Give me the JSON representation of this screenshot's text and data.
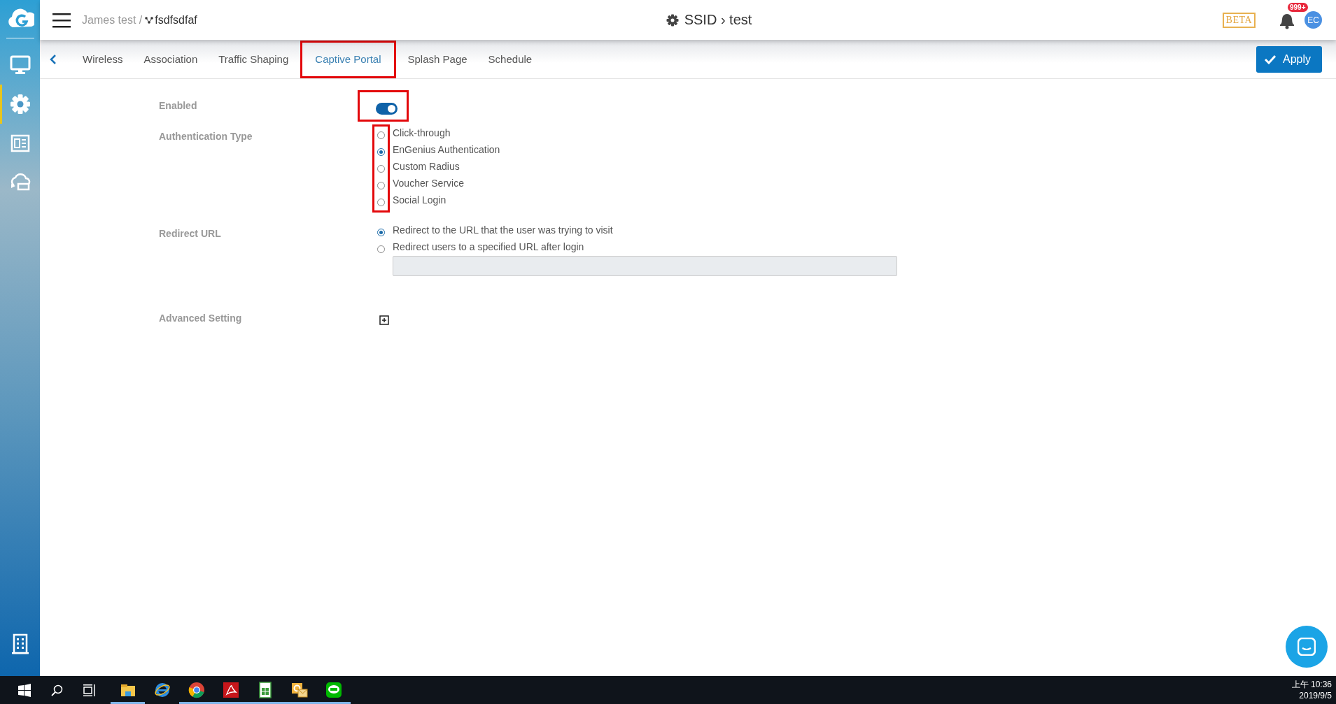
{
  "sidebar": {
    "items": [
      {
        "kind": "monitor",
        "selected": false
      },
      {
        "kind": "gear",
        "selected": true
      },
      {
        "kind": "news",
        "selected": false
      },
      {
        "kind": "cloud",
        "selected": false
      },
      {
        "kind": "building",
        "selected": false
      }
    ]
  },
  "header": {
    "org": "James test /",
    "network": "fsdfsdfaf",
    "title": "SSID › test",
    "beta": "BETA",
    "notification_count": "999+",
    "avatar": "EC"
  },
  "tabs": [
    {
      "label": "Wireless",
      "selected": false,
      "highlighted": false
    },
    {
      "label": "Association",
      "selected": false,
      "highlighted": false
    },
    {
      "label": "Traffic Shaping",
      "selected": false,
      "highlighted": false
    },
    {
      "label": "Captive Portal",
      "selected": true,
      "highlighted": true
    },
    {
      "label": "Splash Page",
      "selected": false,
      "highlighted": false
    },
    {
      "label": "Schedule",
      "selected": false,
      "highlighted": false
    }
  ],
  "apply_button": "Apply",
  "form": {
    "enabled": {
      "label": "Enabled",
      "on": true,
      "highlighted": true
    },
    "authentication_type": {
      "label": "Authentication Type",
      "highlighted": true,
      "options": [
        {
          "label": "Click-through",
          "selected": false
        },
        {
          "label": "EnGenius Authentication",
          "selected": true
        },
        {
          "label": "Custom Radius",
          "selected": false
        },
        {
          "label": "Voucher Service",
          "selected": false
        },
        {
          "label": "Social Login",
          "selected": false
        }
      ]
    },
    "redirect_url": {
      "label": "Redirect URL",
      "highlighted": false,
      "options": [
        {
          "label": "Redirect to the URL that the user was trying to visit",
          "selected": true
        },
        {
          "label": "Redirect users to a specified URL after login",
          "selected": false
        }
      ],
      "url_field": {
        "disabled": true
      }
    },
    "advanced_setting": {
      "label": "Advanced Setting",
      "expanded": false
    }
  },
  "taskbar": {
    "apps": [
      {
        "kind": "explorer",
        "running": true
      },
      {
        "kind": "ie",
        "running": false
      },
      {
        "kind": "chrome",
        "running": true
      },
      {
        "kind": "acrobat",
        "running": true
      },
      {
        "kind": "calc",
        "running": true
      },
      {
        "kind": "outlook",
        "running": true
      },
      {
        "kind": "line",
        "running": true
      }
    ],
    "time": "上午 10:36",
    "date": "2019/9/5"
  }
}
